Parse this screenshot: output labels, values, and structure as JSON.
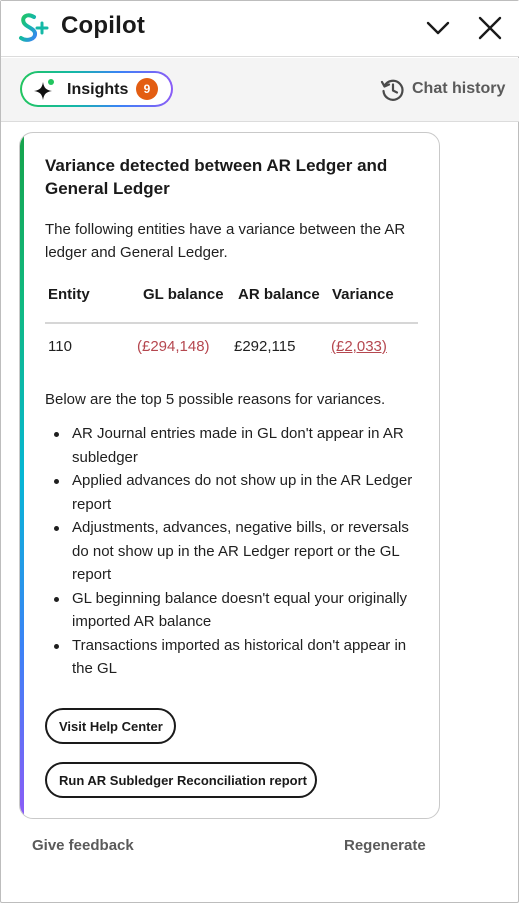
{
  "app": {
    "title": "Copilot"
  },
  "tabs": {
    "insights_label": "Insights",
    "insights_count": "9",
    "history_label": "Chat history"
  },
  "insight": {
    "title": "Variance detected between AR Ledger and General Ledger",
    "intro": "The following entities have a variance between the AR ledger and General Ledger.",
    "table": {
      "headers": [
        "Entity",
        "GL balance",
        "AR balance",
        "Variance"
      ],
      "rows": [
        {
          "entity": "110",
          "gl_balance": "(£294,148)",
          "ar_balance": "£292,115",
          "variance": "(£2,033)"
        }
      ]
    },
    "reasons_heading": "Below are the top 5 possible reasons for variances.",
    "reasons": [
      "AR Journal entries made in GL don't appear in AR subledger",
      "Applied advances do not show up in the AR Ledger report",
      "Adjustments, advances, negative bills, or reversals do not show up in the AR Ledger report or the GL report",
      "GL beginning balance doesn't equal your originally imported AR balance",
      "Transactions imported as historical don't appear in the GL"
    ],
    "buttons": {
      "help": "Visit Help Center",
      "run_report": "Run AR Subledger Reconciliation report"
    }
  },
  "footer": {
    "feedback": "Give feedback",
    "regenerate": "Regenerate"
  },
  "colors": {
    "badge": "#e35d12",
    "negative": "#b5474f",
    "accent_gradient": [
      "#16a34a",
      "#06b6d4",
      "#3b82f6",
      "#8b5cf6"
    ]
  }
}
